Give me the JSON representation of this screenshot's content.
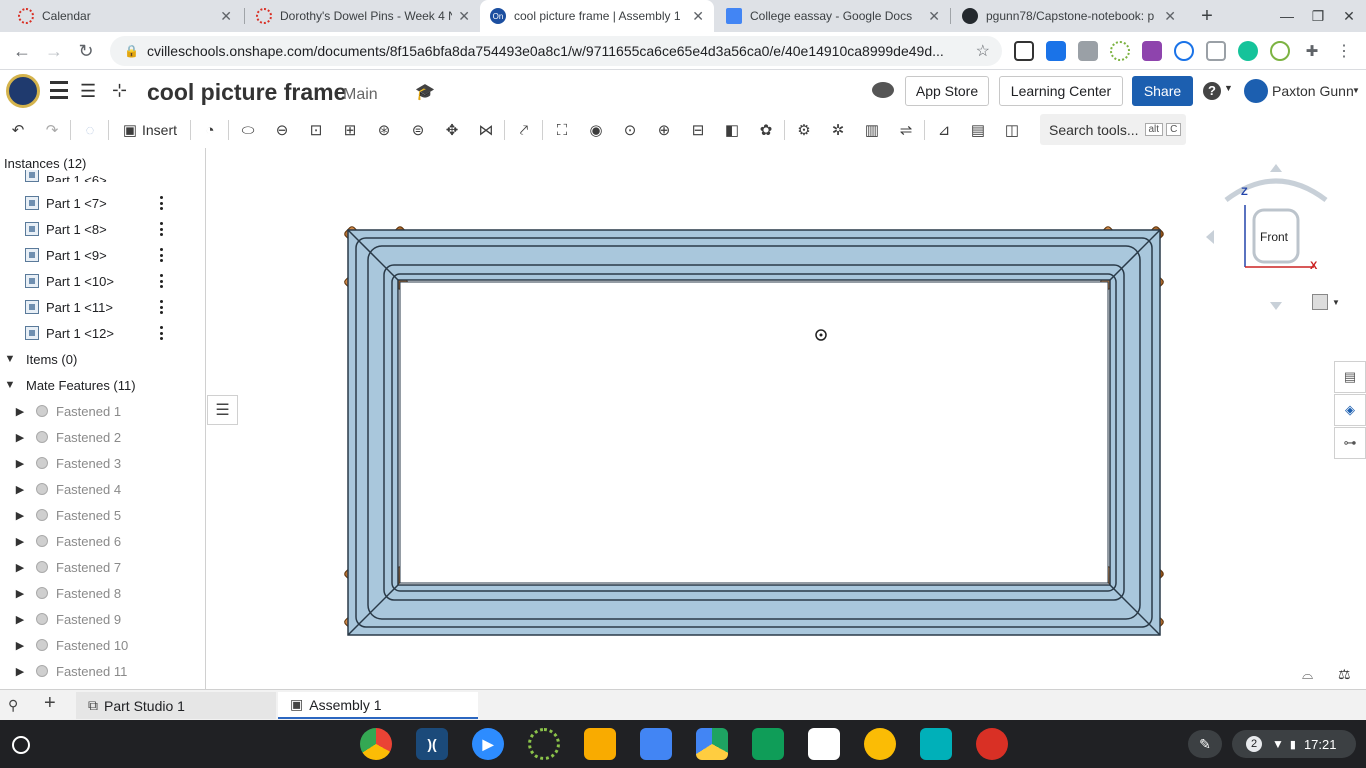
{
  "browser": {
    "tabs": [
      {
        "title": "Calendar"
      },
      {
        "title": "Dorothy's Dowel Pins - Week 4 N"
      },
      {
        "title": "cool picture frame | Assembly 1"
      },
      {
        "title": "College eassay - Google Docs"
      },
      {
        "title": "pgunn78/Capstone-notebook: p"
      }
    ],
    "url": "cvilleschools.onshape.com/documents/8f15a6bfa8da754493e0a8c1/w/9711655ca6ce65e4d3a56ca0/e/40e14910ca8999de49d..."
  },
  "app": {
    "doc_title": "cool picture frame",
    "branch": "Main",
    "app_store": "App Store",
    "learning_center": "Learning Center",
    "share": "Share",
    "user_name": "Paxton Gunn"
  },
  "toolbar": {
    "insert": "Insert",
    "search_placeholder": "Search tools...",
    "shortcut_alt": "alt",
    "shortcut_key": "C"
  },
  "tree": {
    "instances_header": "Instances (12)",
    "partial_item": "Part 1 <6>",
    "parts": [
      "Part 1 <7>",
      "Part 1 <8>",
      "Part 1 <9>",
      "Part 1 <10>",
      "Part 1 <11>",
      "Part 1 <12>"
    ],
    "items_header": "Items (0)",
    "mates_header": "Mate Features (11)",
    "mates": [
      "Fastened 1",
      "Fastened 2",
      "Fastened 3",
      "Fastened 4",
      "Fastened 5",
      "Fastened 6",
      "Fastened 7",
      "Fastened 8",
      "Fastened 9",
      "Fastened 10",
      "Fastened 11"
    ]
  },
  "viewcube": {
    "face": "Front",
    "axis_z": "Z",
    "axis_x": "X"
  },
  "bottom_tabs": [
    {
      "label": "Part Studio 1"
    },
    {
      "label": "Assembly 1"
    }
  ],
  "taskbar": {
    "notifications": "2",
    "time": "17:21"
  },
  "colors": {
    "share_button": "#1c5fb0",
    "frame_metal": "#a9c7dc",
    "dowel": "#b8732e",
    "active_tab_underline": "#2b66c0"
  }
}
